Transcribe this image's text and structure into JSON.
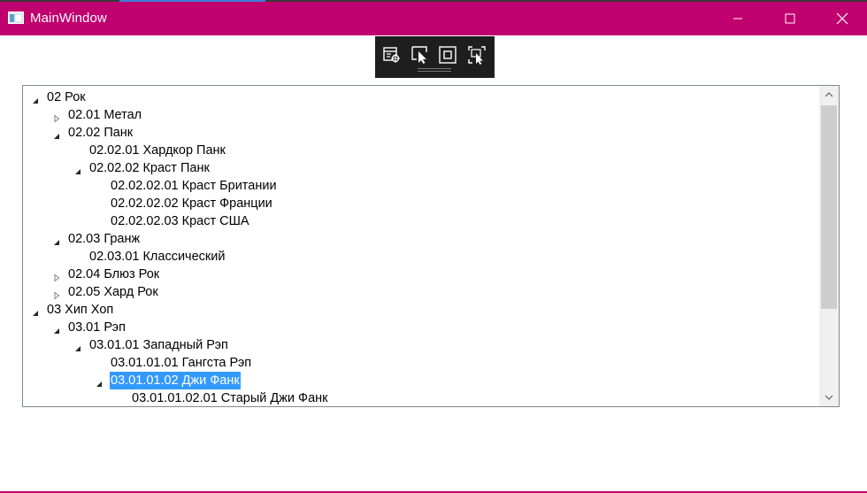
{
  "window": {
    "title": "MainWindow",
    "accent_color": "#c0006e"
  },
  "debug_toolbar": {
    "icons": [
      "live-visual-tree-icon",
      "select-element-icon",
      "display-layout-adorners-icon",
      "track-focused-element-icon"
    ]
  },
  "tree": {
    "selected_color": "#3399ff",
    "nodes": [
      {
        "label": "02 Рок",
        "level": 0,
        "state": "expanded"
      },
      {
        "label": "02.01 Метал",
        "level": 1,
        "state": "collapsed"
      },
      {
        "label": "02.02 Панк",
        "level": 1,
        "state": "expanded"
      },
      {
        "label": "02.02.01 Хардкор Панк",
        "level": 2,
        "state": "leaf"
      },
      {
        "label": "02.02.02 Краст Панк",
        "level": 2,
        "state": "expanded"
      },
      {
        "label": "02.02.02.01 Краст Британии",
        "level": 3,
        "state": "leaf"
      },
      {
        "label": "02.02.02.02 Краст Франции",
        "level": 3,
        "state": "leaf"
      },
      {
        "label": "02.02.02.03 Краст США",
        "level": 3,
        "state": "leaf"
      },
      {
        "label": "02.03 Гранж",
        "level": 1,
        "state": "expanded"
      },
      {
        "label": "02.03.01 Классический",
        "level": 2,
        "state": "leaf"
      },
      {
        "label": "02.04 Блюз Рок",
        "level": 1,
        "state": "collapsed"
      },
      {
        "label": "02.05 Хард Рок",
        "level": 1,
        "state": "collapsed"
      },
      {
        "label": "03 Хип Хоп",
        "level": 0,
        "state": "expanded"
      },
      {
        "label": "03.01 Рэп",
        "level": 1,
        "state": "expanded"
      },
      {
        "label": "03.01.01 Западный Рэп",
        "level": 2,
        "state": "expanded"
      },
      {
        "label": "03.01.01.01 Гангста Рэп",
        "level": 3,
        "state": "leaf"
      },
      {
        "label": "03.01.01.02 Джи Фанк",
        "level": 3,
        "state": "expanded",
        "selected": true
      },
      {
        "label": "03.01.01.02.01 Старый Джи Фанк",
        "level": 4,
        "state": "leaf"
      }
    ]
  }
}
